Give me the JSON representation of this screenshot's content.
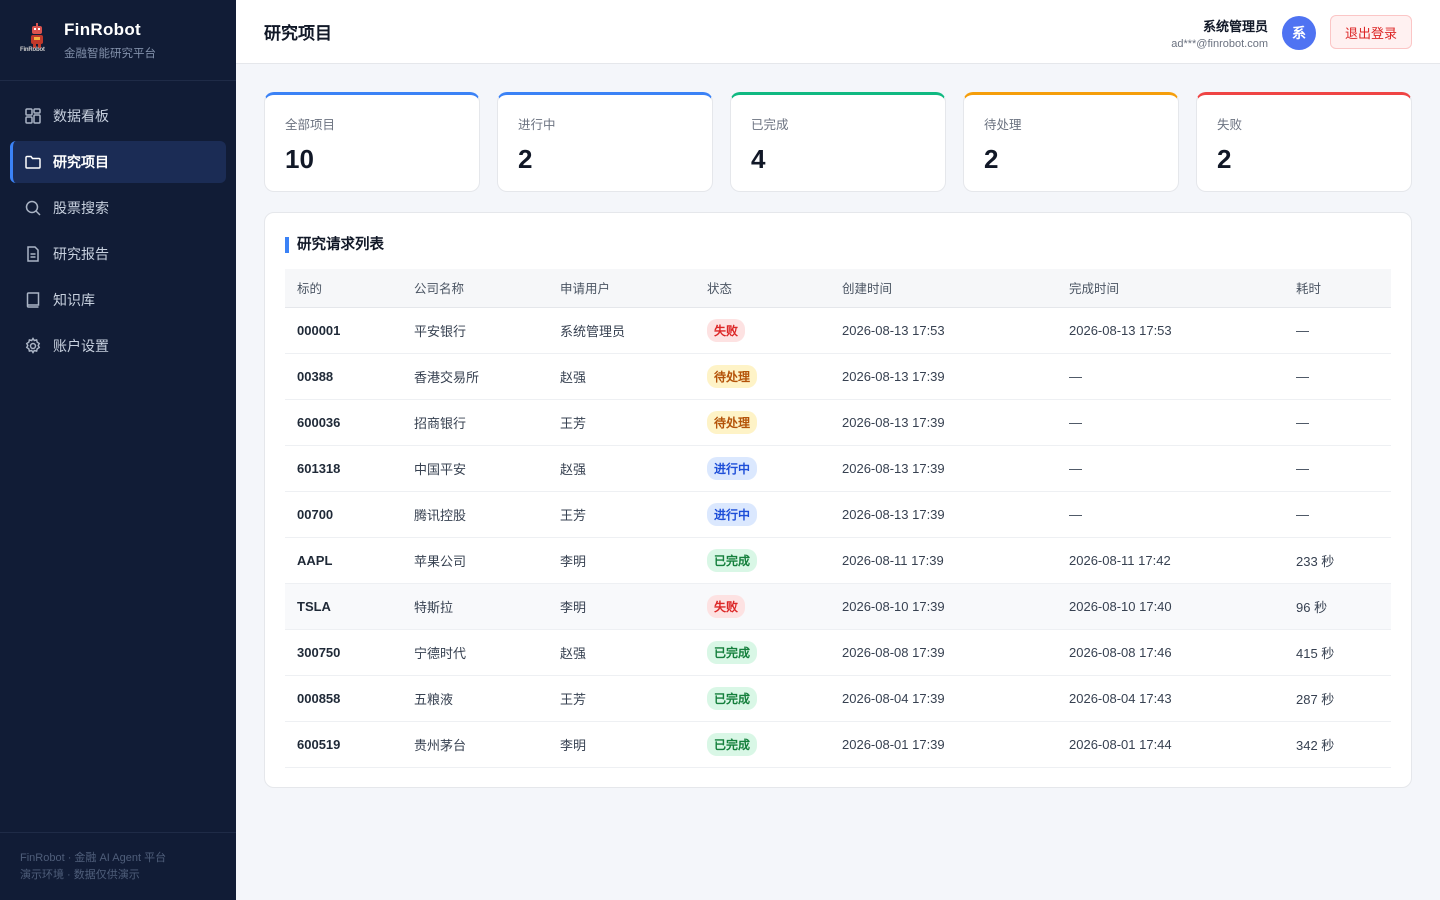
{
  "brand": {
    "name": "FinRobot",
    "subtitle": "金融智能研究平台",
    "logo_text": "FinRobot"
  },
  "nav": [
    {
      "label": "数据看板",
      "icon": "dashboard-icon",
      "active": false
    },
    {
      "label": "研究项目",
      "icon": "folder-icon",
      "active": true
    },
    {
      "label": "股票搜索",
      "icon": "search-icon",
      "active": false
    },
    {
      "label": "研究报告",
      "icon": "document-icon",
      "active": false
    },
    {
      "label": "知识库",
      "icon": "book-icon",
      "active": false
    },
    {
      "label": "账户设置",
      "icon": "gear-icon",
      "active": false
    }
  ],
  "footer": {
    "line1": "FinRobot · 金融 AI Agent 平台",
    "line2": "演示环境 · 数据仅供演示"
  },
  "header": {
    "title": "研究项目",
    "user_name": "系统管理员",
    "user_email": "ad***@finrobot.com",
    "avatar_text": "系",
    "logout_label": "退出登录"
  },
  "stats": [
    {
      "label": "全部项目",
      "value": "10",
      "color": "#3b82f6"
    },
    {
      "label": "进行中",
      "value": "2",
      "color": "#3b82f6"
    },
    {
      "label": "已完成",
      "value": "4",
      "color": "#10b981"
    },
    {
      "label": "待处理",
      "value": "2",
      "color": "#f59e0b"
    },
    {
      "label": "失败",
      "value": "2",
      "color": "#ef4444"
    }
  ],
  "table": {
    "title": "研究请求列表",
    "columns": [
      "标的",
      "公司名称",
      "申请用户",
      "状态",
      "创建时间",
      "完成时间",
      "耗时"
    ],
    "rows": [
      {
        "code": "000001",
        "company": "平安银行",
        "user": "系统管理员",
        "status": "失败",
        "created": "2026-08-13 17:53",
        "finished": "2026-08-13 17:53",
        "duration": "—"
      },
      {
        "code": "00388",
        "company": "香港交易所",
        "user": "赵强",
        "status": "待处理",
        "created": "2026-08-13 17:39",
        "finished": "—",
        "duration": "—"
      },
      {
        "code": "600036",
        "company": "招商银行",
        "user": "王芳",
        "status": "待处理",
        "created": "2026-08-13 17:39",
        "finished": "—",
        "duration": "—"
      },
      {
        "code": "601318",
        "company": "中国平安",
        "user": "赵强",
        "status": "进行中",
        "created": "2026-08-13 17:39",
        "finished": "—",
        "duration": "—"
      },
      {
        "code": "00700",
        "company": "腾讯控股",
        "user": "王芳",
        "status": "进行中",
        "created": "2026-08-13 17:39",
        "finished": "—",
        "duration": "—"
      },
      {
        "code": "AAPL",
        "company": "苹果公司",
        "user": "李明",
        "status": "已完成",
        "created": "2026-08-11 17:39",
        "finished": "2026-08-11 17:42",
        "duration": "233 秒"
      },
      {
        "code": "TSLA",
        "company": "特斯拉",
        "user": "李明",
        "status": "失败",
        "created": "2026-08-10 17:39",
        "finished": "2026-08-10 17:40",
        "duration": "96 秒"
      },
      {
        "code": "300750",
        "company": "宁德时代",
        "user": "赵强",
        "status": "已完成",
        "created": "2026-08-08 17:39",
        "finished": "2026-08-08 17:46",
        "duration": "415 秒"
      },
      {
        "code": "000858",
        "company": "五粮液",
        "user": "王芳",
        "status": "已完成",
        "created": "2026-08-04 17:39",
        "finished": "2026-08-04 17:43",
        "duration": "287 秒"
      },
      {
        "code": "600519",
        "company": "贵州茅台",
        "user": "李明",
        "status": "已完成",
        "created": "2026-08-01 17:39",
        "finished": "2026-08-01 17:44",
        "duration": "342 秒"
      }
    ]
  },
  "status_colors": {
    "失败": {
      "bg": "#fde2e2",
      "fg": "#dc2626"
    },
    "待处理": {
      "bg": "#fef3c7",
      "fg": "#b45309"
    },
    "进行中": {
      "bg": "#dbe8fe",
      "fg": "#1d4ed8"
    },
    "已完成": {
      "bg": "#d9f7e6",
      "fg": "#15803d"
    }
  }
}
